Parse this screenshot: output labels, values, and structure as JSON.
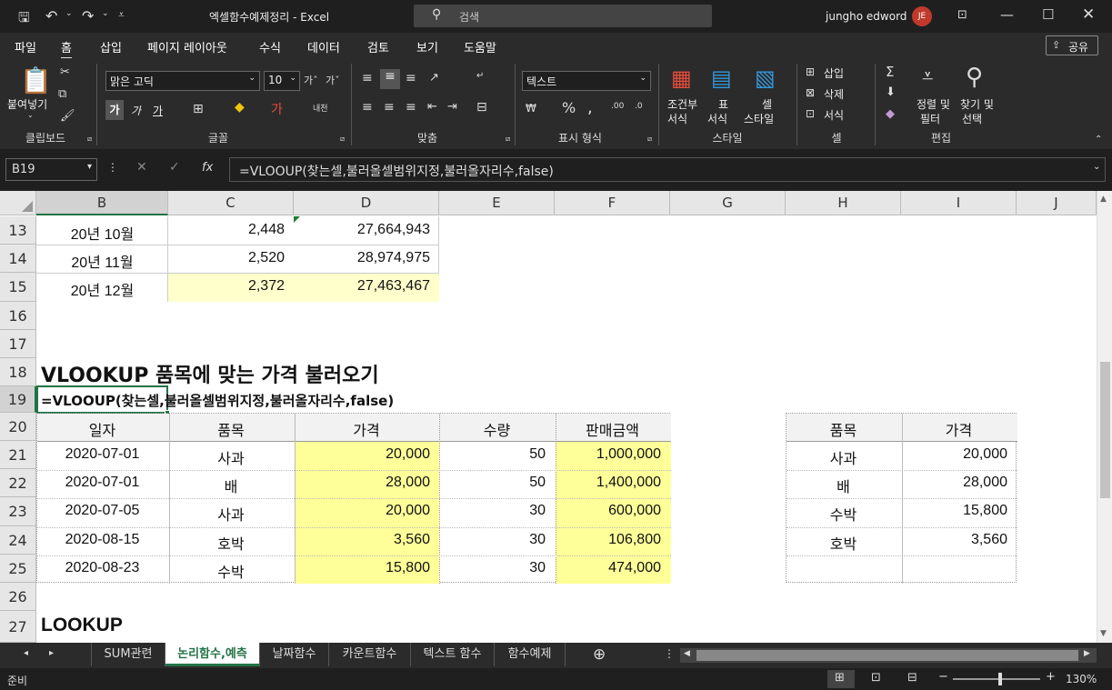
{
  "titlebar": {
    "doc_title": "엑셀함수예제정리  -  Excel",
    "search_placeholder": "검색",
    "user_name": "jungho edword",
    "user_initials": "JE"
  },
  "menu": [
    "파일",
    "홈",
    "삽입",
    "페이지 레이아웃",
    "수식",
    "데이터",
    "검토",
    "보기",
    "도움말"
  ],
  "share_label": "공유",
  "ribbon": {
    "paste_label": "붙여넣기",
    "font_name": "맑은 고딕",
    "font_size": "10",
    "number_format": "텍스트",
    "cond_format_label1": "조건부",
    "cond_format_label2": "서식",
    "table_label1": "표",
    "table_label2": "서식",
    "cell_style_label1": "셀",
    "cell_style_label2": "스타일",
    "insert_label": "삽입",
    "delete_label": "삭제",
    "format_label": "서식",
    "sort_label1": "정렬 및",
    "sort_label2": "필터",
    "find_label1": "찾기 및",
    "find_label2": "선택",
    "bold": "가",
    "italic": "가",
    "underline": "가",
    "groups": [
      "클립보드",
      "글꼴",
      "맞춤",
      "표시 형식",
      "스타일",
      "셀",
      "편집"
    ]
  },
  "formula": {
    "name_box": "B19",
    "fx": "fx",
    "text": "=VLOOUP(찾는셀,불러올셀범위지정,불러올자리수,false)"
  },
  "columns": [
    "B",
    "C",
    "D",
    "E",
    "F",
    "G",
    "H",
    "I",
    "J"
  ],
  "rows": [
    "13",
    "14",
    "15",
    "16",
    "17",
    "18",
    "19",
    "20",
    "21",
    "22",
    "23",
    "24",
    "25",
    "26",
    "27"
  ],
  "top_table": [
    {
      "b": "20년 10월",
      "c": "2,448",
      "d": "27,664,943"
    },
    {
      "b": "20년 11월",
      "c": "2,520",
      "d": "28,974,975"
    },
    {
      "b": "20년 12월",
      "c": "2,372",
      "d": "27,463,467"
    }
  ],
  "heading18": "VLOOKUP 품목에 맞는 가격 불러오기",
  "heading19": "=VLOOUP(찾는셀,불러올셀범위지정,불러올자리수,false)",
  "heading27": "LOOKUP",
  "main_table": {
    "headers": [
      "일자",
      "품목",
      "가격",
      "수량",
      "판매금액"
    ],
    "rows": [
      [
        "2020-07-01",
        "사과",
        "20,000",
        "50",
        "1,000,000"
      ],
      [
        "2020-07-01",
        "배",
        "28,000",
        "50",
        "1,400,000"
      ],
      [
        "2020-07-05",
        "사과",
        "20,000",
        "30",
        "600,000"
      ],
      [
        "2020-08-15",
        "호박",
        "3,560",
        "30",
        "106,800"
      ],
      [
        "2020-08-23",
        "수박",
        "15,800",
        "30",
        "474,000"
      ]
    ]
  },
  "lookup_table": {
    "headers": [
      "품목",
      "가격"
    ],
    "rows": [
      [
        "사과",
        "20,000"
      ],
      [
        "배",
        "28,000"
      ],
      [
        "수박",
        "15,800"
      ],
      [
        "호박",
        "3,560"
      ],
      [
        "",
        ""
      ]
    ]
  },
  "sheet_tabs": [
    "SUM관련",
    "논리함수,예측",
    "날짜함수",
    "카운트함수",
    "텍스트 함수",
    "함수예제"
  ],
  "active_tab_index": 1,
  "status": {
    "ready": "준비",
    "zoom": "130%"
  }
}
